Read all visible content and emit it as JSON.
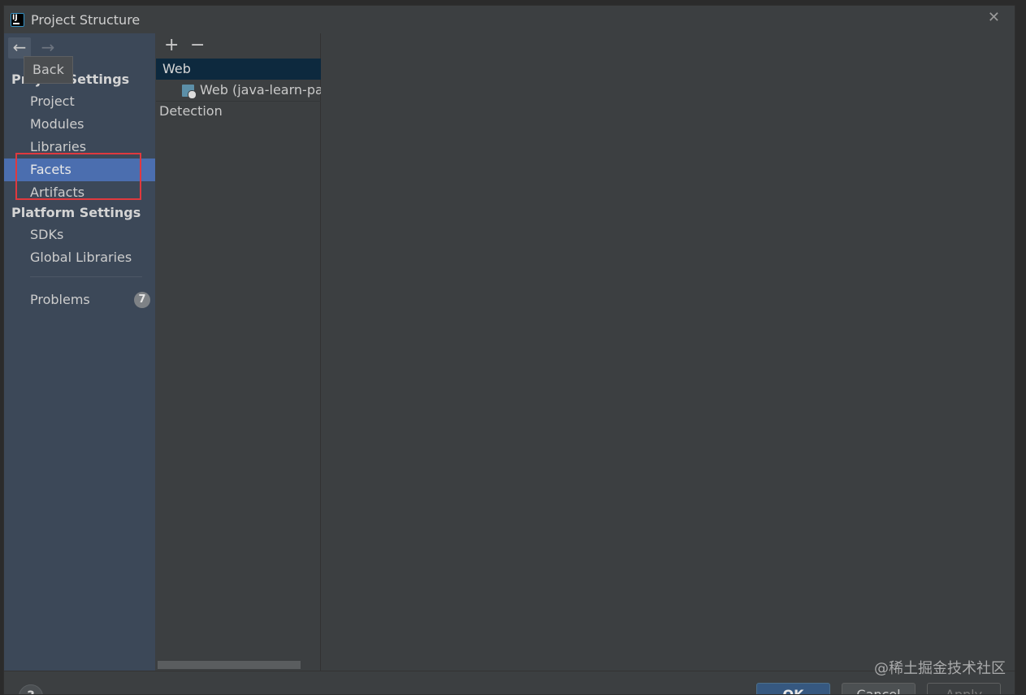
{
  "window": {
    "title": "Project Structure",
    "close_symbol": "✕"
  },
  "sidebar": {
    "back_symbol": "←",
    "forward_symbol": "→",
    "tooltip": "Back",
    "project_settings_title": "Project Settings",
    "project_items": [
      {
        "label": "Project"
      },
      {
        "label": "Modules"
      },
      {
        "label": "Libraries"
      },
      {
        "label": "Facets",
        "selected": true
      },
      {
        "label": "Artifacts"
      }
    ],
    "platform_settings_title": "Platform Settings",
    "platform_items": [
      {
        "label": "SDKs"
      },
      {
        "label": "Global Libraries"
      }
    ],
    "problems": {
      "label": "Problems",
      "count": "7"
    }
  },
  "middle": {
    "add_symbol": "+",
    "remove_symbol": "−",
    "tree": {
      "group": "Web",
      "item": "Web (java-learn-par",
      "detection": "Detection"
    }
  },
  "footer": {
    "help": "?",
    "ok": "OK",
    "cancel": "Cancel",
    "apply": "Apply"
  },
  "watermark": "@稀土掘金技术社区",
  "colors": {
    "selection": "#4b6eaf",
    "tree_selection": "#0d293e",
    "highlight": "#e0393e",
    "ok_button": "#365880"
  }
}
